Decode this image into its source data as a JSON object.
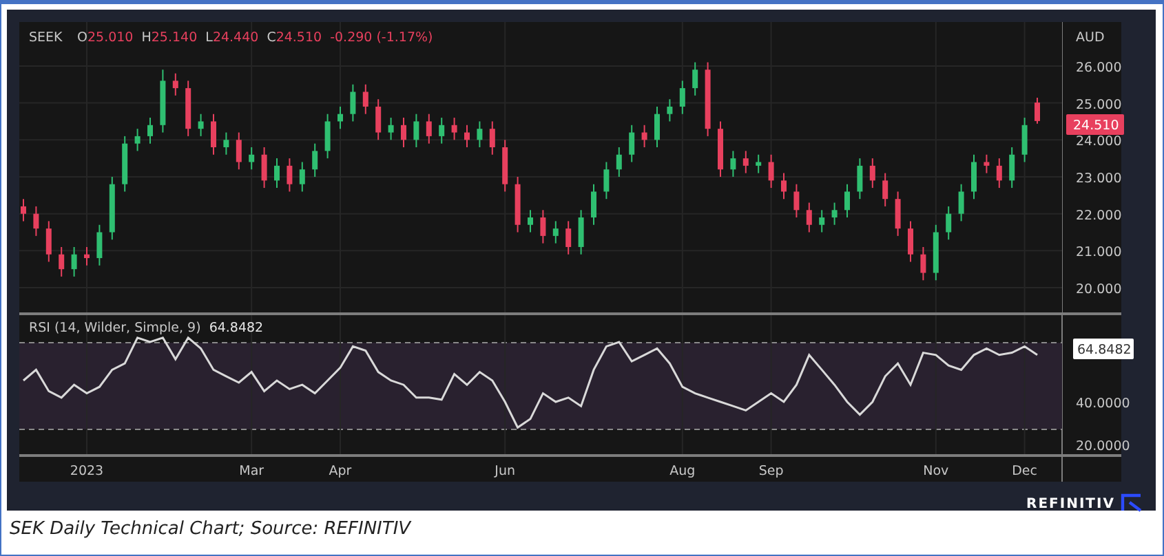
{
  "price_pane": {
    "symbol": "SEEK",
    "ohlc": [
      {
        "label": "O",
        "value": "25.010"
      },
      {
        "label": "H",
        "value": "25.140"
      },
      {
        "label": "L",
        "value": "24.440"
      },
      {
        "label": "C",
        "value": "24.510"
      }
    ],
    "change": "-0.290 (-1.17%)",
    "currency": "AUD",
    "last_price": "24.510",
    "chart_data": {
      "type": "candlestick",
      "ylim": [
        19.33,
        27.19
      ],
      "grid": true,
      "yticks": [
        {
          "value": 26,
          "label": "26.000"
        },
        {
          "value": 25,
          "label": "25.000"
        },
        {
          "value": 24,
          "label": "24.000"
        },
        {
          "value": 23,
          "label": "23.000"
        },
        {
          "value": 22,
          "label": "22.000"
        },
        {
          "value": 21,
          "label": "21.000"
        },
        {
          "value": 20,
          "label": "20.000"
        }
      ],
      "ohlc": [
        [
          22.2,
          22.4,
          21.8,
          22.0
        ],
        [
          22.0,
          22.2,
          21.4,
          21.6
        ],
        [
          21.6,
          21.8,
          20.7,
          20.9
        ],
        [
          20.9,
          21.1,
          20.3,
          20.5
        ],
        [
          20.5,
          21.1,
          20.3,
          20.9
        ],
        [
          20.9,
          21.1,
          20.6,
          20.8
        ],
        [
          20.8,
          21.7,
          20.6,
          21.5
        ],
        [
          21.5,
          23.0,
          21.3,
          22.8
        ],
        [
          22.8,
          24.1,
          22.6,
          23.9
        ],
        [
          23.9,
          24.3,
          23.7,
          24.1
        ],
        [
          24.1,
          24.6,
          23.9,
          24.4
        ],
        [
          24.4,
          25.9,
          24.2,
          25.6
        ],
        [
          25.6,
          25.8,
          25.2,
          25.4
        ],
        [
          25.4,
          25.6,
          24.1,
          24.3
        ],
        [
          24.3,
          24.7,
          24.1,
          24.5
        ],
        [
          24.5,
          24.7,
          23.6,
          23.8
        ],
        [
          23.8,
          24.2,
          23.6,
          24.0
        ],
        [
          24.0,
          24.2,
          23.2,
          23.4
        ],
        [
          23.4,
          23.8,
          23.2,
          23.6
        ],
        [
          23.6,
          23.8,
          22.7,
          22.9
        ],
        [
          22.9,
          23.5,
          22.7,
          23.3
        ],
        [
          23.3,
          23.5,
          22.6,
          22.8
        ],
        [
          22.8,
          23.4,
          22.6,
          23.2
        ],
        [
          23.2,
          23.9,
          23.0,
          23.7
        ],
        [
          23.7,
          24.7,
          23.5,
          24.5
        ],
        [
          24.5,
          24.9,
          24.3,
          24.7
        ],
        [
          24.7,
          25.5,
          24.5,
          25.3
        ],
        [
          25.3,
          25.5,
          24.7,
          24.9
        ],
        [
          24.9,
          25.1,
          24.0,
          24.2
        ],
        [
          24.2,
          24.6,
          24.0,
          24.4
        ],
        [
          24.4,
          24.6,
          23.8,
          24.0
        ],
        [
          24.0,
          24.7,
          23.8,
          24.5
        ],
        [
          24.5,
          24.7,
          23.9,
          24.1
        ],
        [
          24.1,
          24.6,
          23.9,
          24.4
        ],
        [
          24.4,
          24.6,
          24.0,
          24.2
        ],
        [
          24.2,
          24.4,
          23.8,
          24.0
        ],
        [
          24.0,
          24.5,
          23.8,
          24.3
        ],
        [
          24.3,
          24.5,
          23.6,
          23.8
        ],
        [
          23.8,
          24.0,
          22.6,
          22.8
        ],
        [
          22.8,
          23.0,
          21.5,
          21.7
        ],
        [
          21.7,
          22.1,
          21.5,
          21.9
        ],
        [
          21.9,
          22.1,
          21.2,
          21.4
        ],
        [
          21.4,
          21.8,
          21.2,
          21.6
        ],
        [
          21.6,
          21.8,
          20.9,
          21.1
        ],
        [
          21.1,
          22.1,
          20.9,
          21.9
        ],
        [
          21.9,
          22.8,
          21.7,
          22.6
        ],
        [
          22.6,
          23.4,
          22.4,
          23.2
        ],
        [
          23.2,
          23.8,
          23.0,
          23.6
        ],
        [
          23.6,
          24.4,
          23.4,
          24.2
        ],
        [
          24.2,
          24.4,
          23.8,
          24.0
        ],
        [
          24.0,
          24.9,
          23.8,
          24.7
        ],
        [
          24.7,
          25.1,
          24.5,
          24.9
        ],
        [
          24.9,
          25.6,
          24.7,
          25.4
        ],
        [
          25.4,
          26.1,
          25.2,
          25.9
        ],
        [
          25.9,
          26.1,
          24.1,
          24.3
        ],
        [
          24.3,
          24.5,
          23.0,
          23.2
        ],
        [
          23.2,
          23.7,
          23.0,
          23.5
        ],
        [
          23.5,
          23.7,
          23.1,
          23.3
        ],
        [
          23.3,
          23.6,
          23.1,
          23.4
        ],
        [
          23.4,
          23.6,
          22.7,
          22.9
        ],
        [
          22.9,
          23.1,
          22.4,
          22.6
        ],
        [
          22.6,
          22.8,
          21.9,
          22.1
        ],
        [
          22.1,
          22.3,
          21.5,
          21.7
        ],
        [
          21.7,
          22.1,
          21.5,
          21.9
        ],
        [
          21.9,
          22.3,
          21.7,
          22.1
        ],
        [
          22.1,
          22.8,
          21.9,
          22.6
        ],
        [
          22.6,
          23.5,
          22.4,
          23.3
        ],
        [
          23.3,
          23.5,
          22.7,
          22.9
        ],
        [
          22.9,
          23.1,
          22.2,
          22.4
        ],
        [
          22.4,
          22.6,
          21.4,
          21.6
        ],
        [
          21.6,
          21.8,
          20.7,
          20.9
        ],
        [
          20.9,
          21.1,
          20.2,
          20.4
        ],
        [
          20.4,
          21.7,
          20.2,
          21.5
        ],
        [
          21.5,
          22.2,
          21.3,
          22.0
        ],
        [
          22.0,
          22.8,
          21.8,
          22.6
        ],
        [
          22.6,
          23.6,
          22.4,
          23.4
        ],
        [
          23.4,
          23.6,
          23.1,
          23.3
        ],
        [
          23.3,
          23.5,
          22.7,
          22.9
        ],
        [
          22.9,
          23.8,
          22.7,
          23.6
        ],
        [
          23.6,
          24.6,
          23.4,
          24.4
        ],
        [
          25.01,
          25.14,
          24.44,
          24.51
        ]
      ]
    }
  },
  "rsi_pane": {
    "params": "(14, Wilder, Simple, 9)",
    "value": "64.8482",
    "last_value": "64.8482",
    "chart_data": {
      "type": "line",
      "ylim": [
        15.5,
        80.6
      ],
      "grid": true,
      "yticks": [
        {
          "value": 40,
          "label": "40.0000"
        },
        {
          "value": 20,
          "label": "20.0000"
        }
      ],
      "categories": [
        null,
        null,
        null,
        null,
        null,
        "2023",
        null,
        null,
        null,
        null,
        null,
        null,
        null,
        null,
        null,
        null,
        null,
        null,
        "Mar",
        null,
        null,
        null,
        null,
        null,
        null,
        "Apr",
        null,
        null,
        null,
        null,
        null,
        null,
        null,
        null,
        null,
        null,
        null,
        null,
        "Jun",
        null,
        null,
        null,
        null,
        null,
        null,
        null,
        null,
        null,
        null,
        null,
        null,
        null,
        "Aug",
        null,
        null,
        null,
        null,
        null,
        null,
        "Sep",
        null,
        null,
        null,
        null,
        null,
        null,
        null,
        null,
        null,
        null,
        null,
        null,
        "Nov",
        null,
        null,
        null,
        null,
        null,
        null,
        "Dec",
        null
      ],
      "series": [
        {
          "name": "RSI",
          "color": "#d9d9d9",
          "values": [
            50,
            55,
            45,
            42,
            48,
            44,
            47,
            55,
            58,
            70,
            68,
            70,
            60,
            70,
            65,
            55,
            52,
            49,
            54,
            45,
            50,
            46,
            48,
            44,
            50,
            56,
            66,
            64,
            54,
            50,
            48,
            42,
            42,
            41,
            53,
            48,
            54,
            50,
            40,
            28,
            32,
            44,
            40,
            42,
            38,
            55,
            66,
            68,
            59,
            62,
            65,
            58,
            47,
            44,
            42,
            40,
            38,
            36,
            40,
            44,
            40,
            48,
            62,
            55,
            48,
            40,
            34,
            40,
            52,
            58,
            48,
            63,
            62,
            57,
            55,
            62,
            65,
            62,
            63,
            66,
            62
          ]
        }
      ]
    }
  },
  "footer": {
    "brand": "REFINITIV"
  },
  "caption": "SEK Daily Technical Chart; Source: REFINITIV"
}
